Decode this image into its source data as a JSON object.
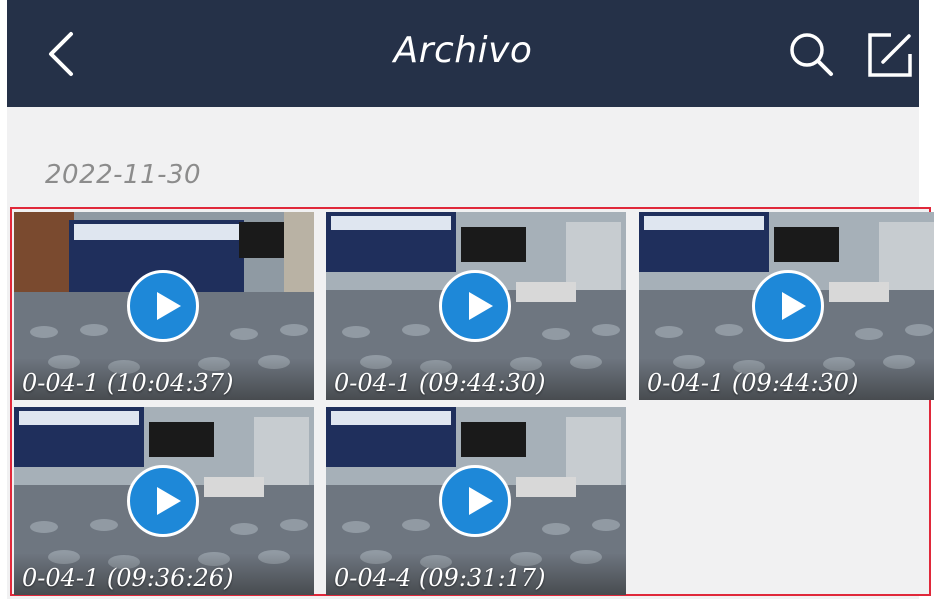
{
  "header": {
    "title": "Archivo",
    "back_icon": "chevron-left-icon",
    "search_icon": "search-icon",
    "edit_icon": "edit-icon"
  },
  "section": {
    "date": "2022-11-30"
  },
  "videos": [
    {
      "caption": "0-04-1 (10:04:37)"
    },
    {
      "caption": "0-04-1 (09:44:30)"
    },
    {
      "caption": "0-04-1 (09:44:30)"
    },
    {
      "caption": "0-04-1 (09:36:26)"
    },
    {
      "caption": "0-04-4 (09:31:17)"
    }
  ],
  "colors": {
    "header_bg": "#253148",
    "play_button": "#1e88d8",
    "selection_border": "#e0283a"
  }
}
